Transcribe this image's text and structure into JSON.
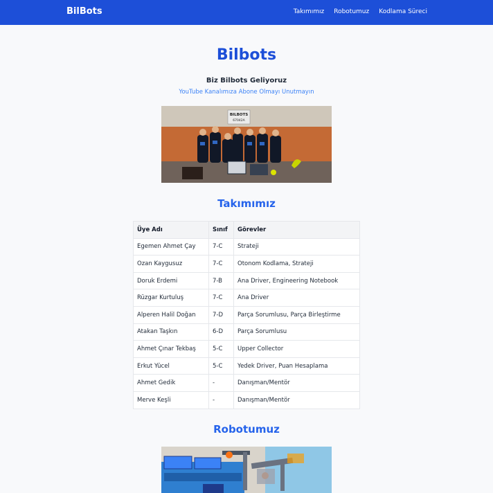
{
  "navbar": {
    "brand": "BilBots",
    "links": [
      "Takımımız",
      "Robotumuz",
      "Kodlama Süreci"
    ]
  },
  "hero": {
    "title": "Bilbots",
    "subtitle": "Biz Bilbots Geliyoruz",
    "link_text": "YouTube Kanalımıza Abone Olmayı Unutmayın",
    "banner_text": "BILBOTS",
    "banner_number": "67042A"
  },
  "team": {
    "title": "Takımımız",
    "headers": [
      "Üye Adı",
      "Sınıf",
      "Görevler"
    ],
    "rows": [
      [
        "Egemen Ahmet Çay",
        "7-C",
        "Strateji"
      ],
      [
        "Ozan Kaygusuz",
        "7-C",
        "Otonom Kodlama, Strateji"
      ],
      [
        "Doruk Erdemi",
        "7-B",
        "Ana Driver, Engineering Notebook"
      ],
      [
        "Rüzgar Kurtuluş",
        "7-C",
        "Ana Driver"
      ],
      [
        "Alperen Halil Doğan",
        "7-D",
        "Parça Sorumlusu, Parça Birleştirme"
      ],
      [
        "Atakan Taşkın",
        "6-D",
        "Parça Sorumlusu"
      ],
      [
        "Ahmet Çınar Tekbaş",
        "5-C",
        "Upper Collector"
      ],
      [
        "Erkut Yücel",
        "5-C",
        "Yedek Driver, Puan Hesaplama"
      ],
      [
        "Ahmet Gedik",
        "-",
        "Danışman/Mentör"
      ],
      [
        "Merve Keşli",
        "-",
        "Danışman/Mentör"
      ]
    ]
  },
  "robot": {
    "title": "Robotumuz"
  }
}
